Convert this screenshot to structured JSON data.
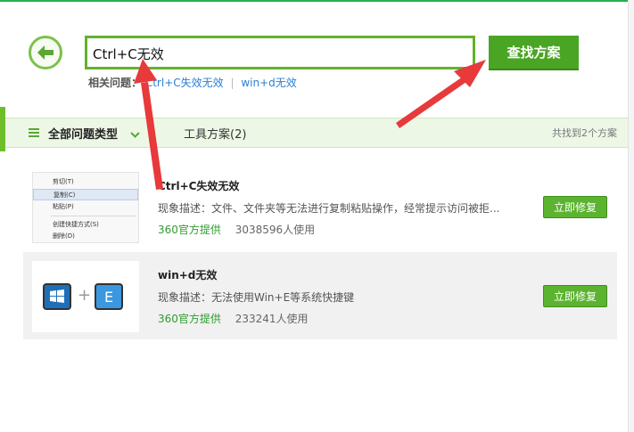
{
  "search": {
    "query": "Ctrl+C无效",
    "button_label": "查找方案"
  },
  "related": {
    "label": "相关问题：",
    "links": [
      "Ctrl+C失效无效",
      "win+d无效"
    ],
    "separator": "|"
  },
  "tabs": {
    "all_types": "全部问题类型",
    "tool_solutions": "工具方案(2)",
    "found_count": "共找到2个方案"
  },
  "results": [
    {
      "title": "Ctrl+C失效无效",
      "description": "现象描述：文件、文件夹等无法进行复制粘贴操作，经常提示访问被拒...",
      "provider": "360官方提供",
      "usage": "3038596人使用",
      "fix_label": "立即修复",
      "thumb_menu": [
        "剪切(T)",
        "复制(C)",
        "粘贴(P)",
        "创建快捷方式(S)",
        "删除(D)"
      ]
    },
    {
      "title": "win+d无效",
      "description": "现象描述：无法使用Win+E等系统快捷键",
      "provider": "360官方提供",
      "usage": "233241人使用",
      "fix_label": "立即修复",
      "thumb_keys": {
        "plus": "+",
        "key": "E"
      }
    }
  ],
  "colors": {
    "accent_green": "#4aa524",
    "annotation_red": "#e8393b",
    "link_blue": "#2a7fd4"
  }
}
